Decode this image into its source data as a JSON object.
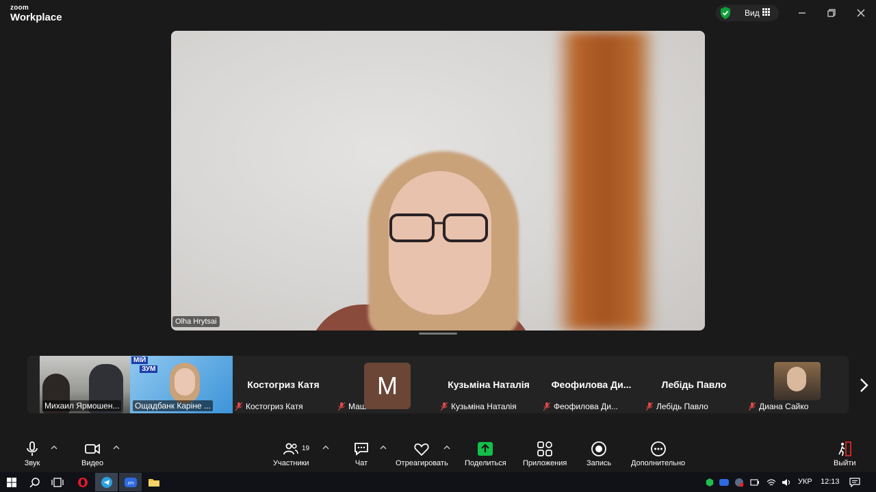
{
  "app": {
    "brand_line1": "zoom",
    "brand_line2": "Workplace",
    "view_label": "Вид"
  },
  "main_video": {
    "speaker_name": "Olha Hrytsai"
  },
  "thumbnails": [
    {
      "name": "Михаил Ярмошен...",
      "video": true
    },
    {
      "name": "Ощадбанк Каріне ...",
      "video": true,
      "overlay_lines": [
        "МІЙ",
        "ЗУМ"
      ]
    },
    {
      "title": "Костогриз Катя",
      "name": "Костогриз Катя",
      "muted": true
    },
    {
      "avatar_letter": "M",
      "name": "Маша Малая",
      "muted": true
    },
    {
      "title": "Кузьміна Наталія",
      "name": "Кузьміна Наталія",
      "muted": true
    },
    {
      "title": "Феофилова  Ди...",
      "name": "Феофилова Ди...",
      "muted": true
    },
    {
      "title": "Лебідь Павло",
      "name": "Лебідь Павло",
      "muted": true
    },
    {
      "name": "Диана Сайко",
      "muted": true,
      "video": true
    }
  ],
  "toolbar": {
    "audio": "Звук",
    "video": "Видео",
    "participants": "Участники",
    "participants_count": "19",
    "chat": "Чат",
    "react": "Отреагировать",
    "share": "Поделиться",
    "apps": "Приложения",
    "record": "Запись",
    "more": "Дополнительно",
    "leave": "Выйти"
  },
  "taskbar": {
    "language": "УКР",
    "time": "12:13"
  },
  "colors": {
    "accent_green": "#0e9f3a",
    "share_green": "#12c04a",
    "leave_red": "#e02828",
    "muted_red": "#e04848"
  }
}
